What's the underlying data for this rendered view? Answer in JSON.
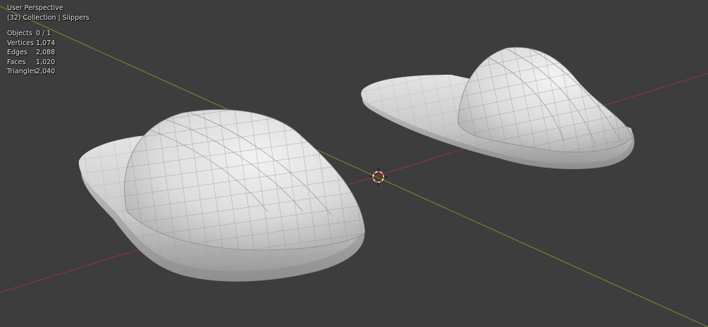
{
  "viewport": {
    "view_name": "User Perspective",
    "collection_info": "(32) Collection | Slippers",
    "stats": [
      {
        "label": "Objects",
        "value": "0 / 1"
      },
      {
        "label": "Vertices",
        "value": "1,074"
      },
      {
        "label": "Edges",
        "value": "2,088"
      },
      {
        "label": "Faces",
        "value": "1,020"
      },
      {
        "label": "Triangles",
        "value": "2,040"
      }
    ]
  },
  "colors": {
    "background": "#3d3d3d",
    "x_axis": "#a0323c",
    "y_axis": "#6b9a2a",
    "mesh_surface": "#d6d6d6",
    "mesh_wire": "#9a9a9a",
    "cursor_ring": "#ff6a3d"
  },
  "icons": {
    "cursor": "3d-cursor-icon"
  }
}
